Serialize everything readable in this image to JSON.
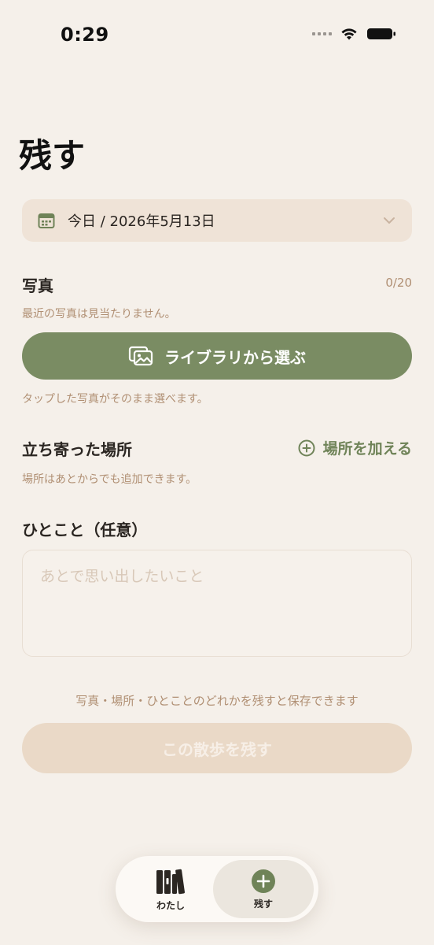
{
  "status_bar": {
    "time": "0:29"
  },
  "header": {
    "title": "残す"
  },
  "date_picker": {
    "label": "今日 / 2026年5月13日"
  },
  "photos": {
    "label": "写真",
    "counter": "0/20",
    "empty_message": "最近の写真は見当たりません。",
    "library_button": "ライブラリから選ぶ",
    "tap_hint": "タップした写真がそのまま選べます。"
  },
  "places": {
    "label": "立ち寄った場所",
    "add_button": "場所を加える",
    "hint": "場所はあとからでも追加できます。"
  },
  "note": {
    "label": "ひとこと（任意）",
    "placeholder": "あとで思い出したいこと"
  },
  "save": {
    "hint": "写真・場所・ひとことのどれかを残すと保存できます",
    "button": "この散歩を残す"
  },
  "tab_bar": {
    "tabs": [
      {
        "label": "わたし",
        "icon": "books-icon"
      },
      {
        "label": "残す",
        "icon": "plus-circle-icon"
      }
    ]
  },
  "colors": {
    "background": "#f5f0ea",
    "accent_green": "#7a8c63",
    "hint_brown": "#b08f73",
    "date_bg": "#efe3d7",
    "disabled_button": "#ead9c7"
  }
}
